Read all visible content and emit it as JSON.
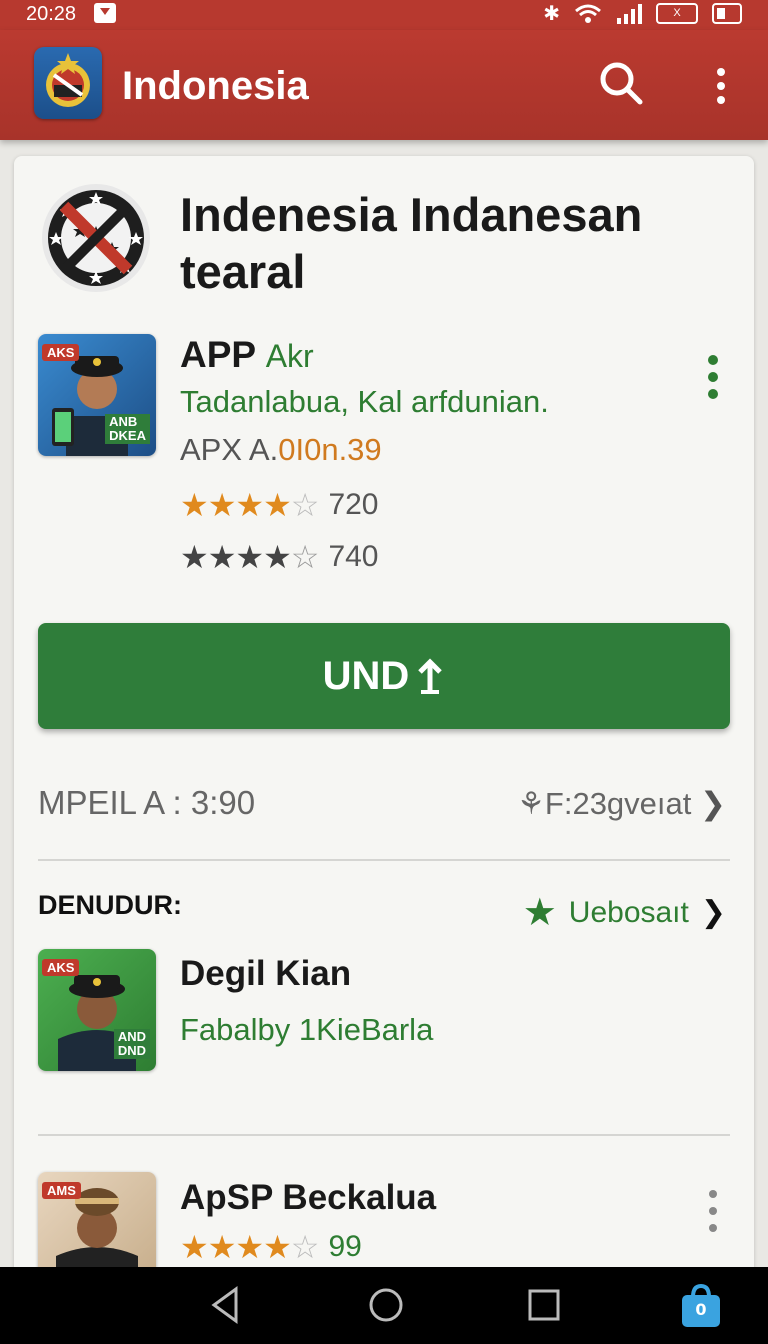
{
  "status_bar": {
    "time": "20:28",
    "battery_label": "X"
  },
  "app_bar": {
    "title": "Indonesia"
  },
  "header": {
    "title": "Indenesia Indanesan tearal"
  },
  "featured": {
    "thumb_tag": "AKS",
    "thumb_tag2": "ANB",
    "thumb_tag3": "DKEA",
    "name": "APP",
    "name_sub": "Akr",
    "developer": "Tadanlabua, Kal arfdunian.",
    "version_prefix": "APX A.",
    "version_value": "0I0n.39",
    "rating1": {
      "stars": 4,
      "count": "720"
    },
    "rating2": {
      "stars": 4,
      "count": "740"
    }
  },
  "install_button": {
    "label": "UND",
    "icon": "upload-arrow-icon"
  },
  "meta": {
    "left": "MPEIL A : 3:90",
    "right": "F:23gveıat"
  },
  "section": {
    "title": "DENUDUR:",
    "link": "Uebosaıt"
  },
  "list": [
    {
      "tag": "AKS",
      "tag2": "AND",
      "tag3": "DND",
      "name": "Degil Kian",
      "subtitle": "Fabalby 1KieBarla"
    },
    {
      "tag": "AMS",
      "name": "ApSP Beckalua",
      "rating_stars": 4,
      "rating_count": "99"
    }
  ],
  "colors": {
    "primary": "#b7392f",
    "accent": "#2f7d3a",
    "star": "#e08a1e"
  }
}
